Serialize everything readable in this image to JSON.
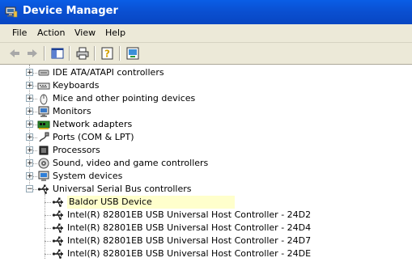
{
  "window": {
    "title": "Device Manager"
  },
  "menu": {
    "file": "File",
    "action": "Action",
    "view": "View",
    "help": "Help"
  },
  "toolbar": {
    "buttons": [
      "back-icon",
      "forward-icon",
      "show-hide-console-tree-icon",
      "print-icon",
      "help-icon",
      "computer-properties-icon"
    ]
  },
  "tree": {
    "categories": [
      {
        "label": "IDE ATA/ATAPI controllers",
        "icon": "ide-controller-icon",
        "expanded": false
      },
      {
        "label": "Keyboards",
        "icon": "keyboard-icon",
        "expanded": false
      },
      {
        "label": "Mice and other pointing devices",
        "icon": "mouse-icon",
        "expanded": false
      },
      {
        "label": "Monitors",
        "icon": "monitor-icon",
        "expanded": false
      },
      {
        "label": "Network adapters",
        "icon": "network-adapter-icon",
        "expanded": false
      },
      {
        "label": "Ports (COM & LPT)",
        "icon": "port-icon",
        "expanded": false
      },
      {
        "label": "Processors",
        "icon": "processor-icon",
        "expanded": false
      },
      {
        "label": "Sound, video and game controllers",
        "icon": "sound-icon",
        "expanded": false
      },
      {
        "label": "System devices",
        "icon": "system-devices-icon",
        "expanded": false
      },
      {
        "label": "Universal Serial Bus controllers",
        "icon": "usb-icon",
        "expanded": true
      }
    ],
    "usb_children": [
      {
        "label": "Baldor USB Device",
        "icon": "usb-icon",
        "selected": true
      },
      {
        "label": "Intel(R) 82801EB USB Universal Host Controller - 24D2",
        "icon": "usb-icon"
      },
      {
        "label": "Intel(R) 82801EB USB Universal Host Controller - 24D4",
        "icon": "usb-icon"
      },
      {
        "label": "Intel(R) 82801EB USB Universal Host Controller - 24D7",
        "icon": "usb-icon"
      },
      {
        "label": "Intel(R) 82801EB USB Universal Host Controller - 24DE",
        "icon": "usb-icon"
      }
    ],
    "expand_symbol": "+",
    "collapse_symbol": "−"
  }
}
